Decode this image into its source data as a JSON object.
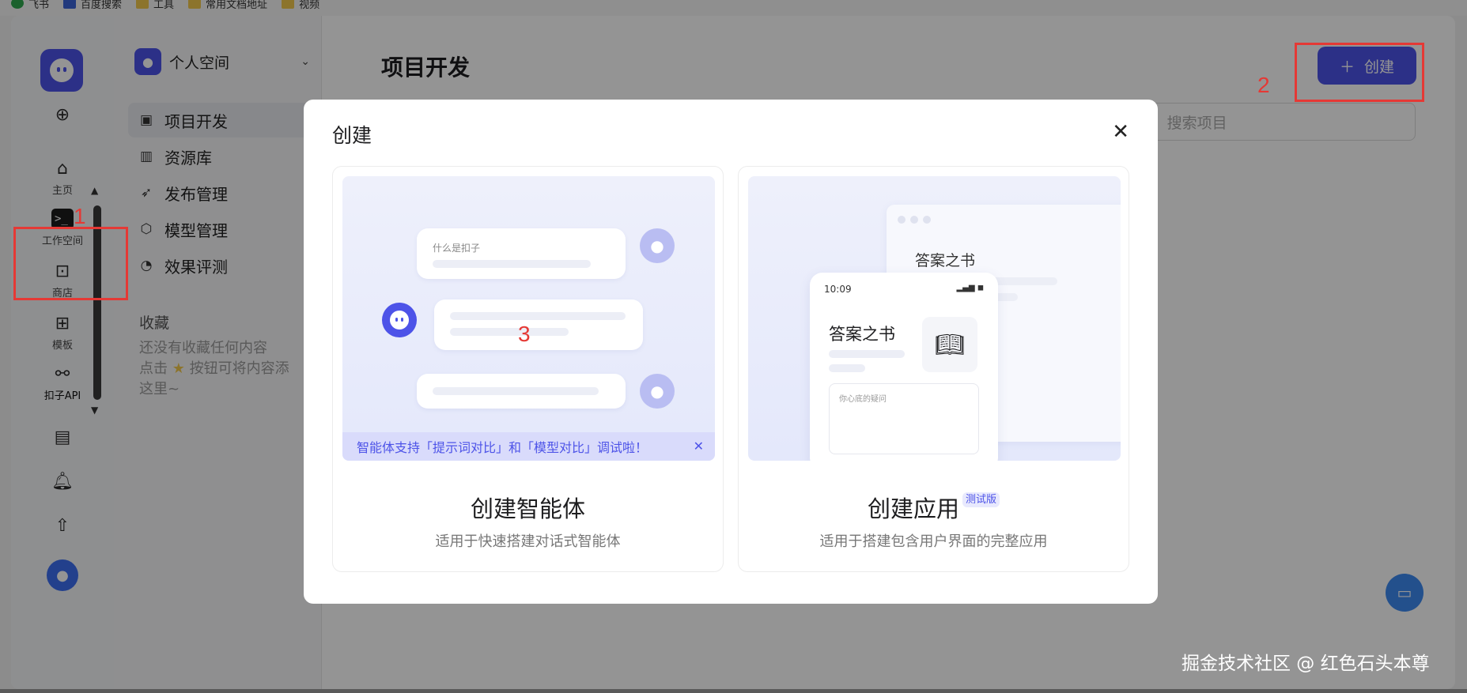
{
  "bookmarks": [
    "飞书",
    "百度搜索",
    "工具",
    "常用文档地址",
    "视频"
  ],
  "rail": {
    "items": [
      {
        "label": "主页",
        "icon": "home-icon"
      },
      {
        "label": "工作空间",
        "icon": "terminal-icon"
      },
      {
        "label": "商店",
        "icon": "store-icon"
      },
      {
        "label": "模板",
        "icon": "template-icon"
      },
      {
        "label": "扣子API",
        "icon": "api-icon"
      }
    ],
    "active_glyph": ">_"
  },
  "annotations": {
    "n1": "1",
    "n2": "2",
    "n3": "3"
  },
  "sidebar": {
    "space_name": "个人空间",
    "nav": [
      {
        "label": "项目开发",
        "icon": "bot-icon"
      },
      {
        "label": "资源库",
        "icon": "library-icon"
      },
      {
        "label": "发布管理",
        "icon": "rocket-icon"
      },
      {
        "label": "模型管理",
        "icon": "model-icon"
      },
      {
        "label": "效果评测",
        "icon": "gauge-icon"
      }
    ],
    "favorites_title": "收藏",
    "favorites_empty_1": "还没有收藏任何内容",
    "favorites_empty_2": "点击",
    "favorites_empty_3": "按钮可将内容添",
    "favorites_empty_4": "这里~"
  },
  "main": {
    "title": "项目开发",
    "create_label": "创建",
    "search_placeholder": "搜索项目"
  },
  "modal": {
    "title": "创建",
    "agent_card": {
      "name": "创建智能体",
      "desc": "适用于快速搭建对话式智能体",
      "question": "什么是扣子",
      "banner": "智能体支持「提示词对比」和「模型对比」调试啦！"
    },
    "app_card": {
      "name": "创建应用",
      "badge": "测试版",
      "desc": "适用于搭建包含用户界面的完整应用",
      "window_title": "答案之书",
      "phone_time": "10:09",
      "phone_title": "答案之书",
      "phone_placeholder": "你心底的疑问"
    }
  },
  "watermark": "掘金技术社区 @ 红色石头本尊",
  "colors": {
    "accent": "#4d53e8",
    "annotation": "#e53935",
    "fab": "#3d8bf2"
  }
}
